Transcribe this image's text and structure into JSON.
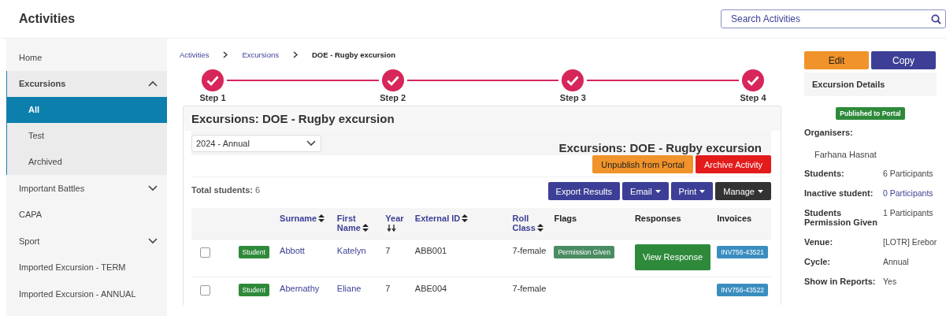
{
  "header": {
    "title": "Activities",
    "search": {
      "placeholder": "Search Activities"
    }
  },
  "sidebar": {
    "items": [
      {
        "label": "Home",
        "selected": false
      },
      {
        "label": "Excursions",
        "selected": false,
        "expanded": true,
        "children": [
          {
            "label": "All",
            "selected": true
          },
          {
            "label": "Test",
            "selected": false
          },
          {
            "label": "Archived",
            "selected": false
          }
        ]
      },
      {
        "label": "Important Battles",
        "selected": false,
        "expanded": false
      },
      {
        "label": "CAPA",
        "selected": false
      },
      {
        "label": "Sport",
        "selected": false,
        "expanded": false
      },
      {
        "label": "Imported Excursion - TERM",
        "selected": false
      },
      {
        "label": "Imported Excursion - ANNUAL",
        "selected": false
      }
    ]
  },
  "breadcrumb": [
    {
      "label": "Activities",
      "kind": "link"
    },
    {
      "label": "Excursions",
      "kind": "link"
    },
    {
      "label": "DOE - Rugby excursion",
      "kind": "current"
    }
  ],
  "steps": [
    {
      "label": "Step 1",
      "done": true
    },
    {
      "label": "Step 2",
      "done": true
    },
    {
      "label": "Step 3",
      "done": true
    },
    {
      "label": "Step 4",
      "done": true
    }
  ],
  "panel": {
    "title": "Excursions: DOE - Rugby excursion",
    "period": "2024 - Annual",
    "heading": "Excursions: DOE - Rugby excursion",
    "buttons": [
      {
        "label": "Unpublish from Portal",
        "kind": "warning"
      },
      {
        "label": "Archive Activity",
        "kind": "danger"
      }
    ],
    "total_label": "Total students:",
    "total_value": "6",
    "actions": [
      {
        "label": "Export Results",
        "kind": "primary",
        "dropdown": false
      },
      {
        "label": "Email",
        "kind": "primary",
        "dropdown": true
      },
      {
        "label": "Print",
        "kind": "primary",
        "dropdown": true
      },
      {
        "label": "Manage",
        "kind": "dark",
        "dropdown": true
      }
    ]
  },
  "table": {
    "columns": [
      {},
      {},
      {
        "label": "Surname",
        "sortable": true,
        "sorted_desc": false
      },
      {
        "label": "First Name",
        "sortable": true,
        "sorted_desc": false
      },
      {
        "label": "Year",
        "sortable": true,
        "sorted_desc": true
      },
      {
        "label": "External ID",
        "sortable": true,
        "sorted_desc": false
      },
      {
        "label": "Roll Class",
        "sortable": true,
        "sorted_desc": false
      },
      {
        "label": "Flags",
        "sortable": false
      },
      {
        "label": "Responses",
        "sortable": false
      },
      {
        "label": "Invoices",
        "sortable": false
      }
    ],
    "rows": [
      {
        "checked": false,
        "role": "Student",
        "surname": "Abbott",
        "first_name": "Katelyn",
        "year": "7",
        "external_id": "ABB001",
        "roll_class": "7-female",
        "flags": [
          "Permission Given"
        ],
        "response": "View Response",
        "invoice": "INV756-43521"
      },
      {
        "checked": false,
        "role": "Student",
        "surname": "Abernathy",
        "first_name": "Eliane",
        "year": "7",
        "external_id": "ABE004",
        "roll_class": "7-female",
        "flags": [],
        "invoice": "INV756-43522"
      }
    ]
  },
  "details": {
    "buttons": [
      {
        "label": "Edit",
        "kind": "warning"
      },
      {
        "label": "Copy",
        "kind": "primary"
      }
    ],
    "title": "Excursion Details",
    "status": "Published to Portal",
    "organisers_label": "Organisers:",
    "organisers": [
      "Farhana Hasnat"
    ],
    "fields": [
      {
        "label": "Students:",
        "value": "6 Participants",
        "link": false
      },
      {
        "label": "Inactive student:",
        "value": "0 Participants",
        "link": true
      },
      {
        "label": "Students Permission Given",
        "value": "1 Participants",
        "link": false
      },
      {
        "label": "Venue:",
        "value": "[LOTR] Erebor",
        "link": false
      },
      {
        "label": "Cycle:",
        "value": "Annual",
        "link": false
      },
      {
        "label": "Show in Reports:",
        "value": "Yes",
        "link": false
      }
    ]
  }
}
